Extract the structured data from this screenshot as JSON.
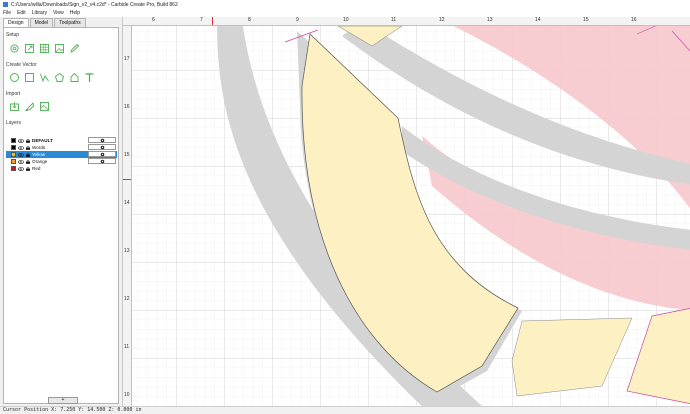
{
  "window": {
    "title": "C:/Users/willa/Downloads/Sign_v2_v4.c2d* - Carbide Create Pro, Build 862"
  },
  "menu": [
    "File",
    "Edit",
    "Library",
    "View",
    "Help"
  ],
  "tabs": [
    {
      "label": "Design",
      "active": true
    },
    {
      "label": "Model",
      "active": false
    },
    {
      "label": "Toolpaths",
      "active": false
    }
  ],
  "sections": {
    "setup": "Setup",
    "create_vector": "Create Vector",
    "import": "Import",
    "layers": "Layers"
  },
  "setup_icons": [
    "settings-icon",
    "import-image-icon",
    "grid-icon",
    "image-icon",
    "pencil-icon"
  ],
  "create_icons": [
    "circle-icon",
    "rectangle-icon",
    "polyline-icon",
    "polygon-icon",
    "pentagon-icon",
    "text-icon"
  ],
  "import_icons": [
    "import-icon",
    "trace-icon",
    "texture-icon"
  ],
  "layers": [
    {
      "name": "DEFAULT",
      "color": "#000000",
      "bold": true,
      "selected": false
    },
    {
      "name": "Words",
      "color": "#000000",
      "bold": false,
      "selected": false
    },
    {
      "name": "Yellow",
      "color": "#f5c400",
      "bold": false,
      "selected": true
    },
    {
      "name": "Orange",
      "color": "#f29d30",
      "bold": false,
      "selected": false
    },
    {
      "name": "Red",
      "color": "#e01010",
      "bold": false,
      "selected": false
    }
  ],
  "add_layer_label": "+",
  "ruler": {
    "top": [
      "6",
      "7",
      "8",
      "9",
      "10",
      "11",
      "12",
      "13",
      "14",
      "15",
      "16"
    ],
    "left": [
      "17",
      "16",
      "15",
      "14",
      "13",
      "12",
      "11",
      "10",
      "9"
    ]
  },
  "colors": {
    "yellow_fill": "#fdf0c2",
    "red_fill": "#f6c8cc",
    "gray_band": "#d4d4d4",
    "selection_blue": "#2a8ad4"
  },
  "status": "Cursor Position X: 7.250 Y: 14.500 Z: 0.000 in"
}
